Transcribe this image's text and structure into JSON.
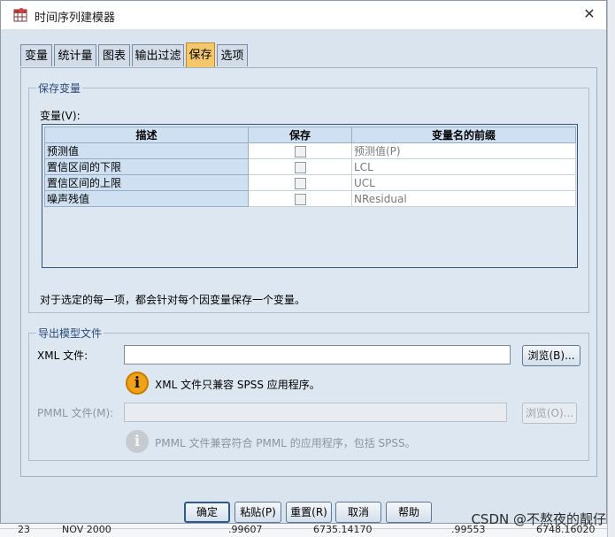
{
  "window": {
    "title": "时间序列建模器",
    "close_label": "✕"
  },
  "tabs": [
    {
      "label": "变量"
    },
    {
      "label": "统计量"
    },
    {
      "label": "图表"
    },
    {
      "label": "输出过滤"
    },
    {
      "label": "保存"
    },
    {
      "label": "选项"
    }
  ],
  "active_tab": "保存",
  "save_group": {
    "legend": "保存变量",
    "var_label": "变量(V):",
    "columns": [
      "描述",
      "保存",
      "变量名的前缀"
    ],
    "rows": [
      {
        "desc": "预测值",
        "save": false,
        "prefix": "预测值(P)"
      },
      {
        "desc": "置信区间的下限",
        "save": false,
        "prefix": "LCL"
      },
      {
        "desc": "置信区间的上限",
        "save": false,
        "prefix": "UCL"
      },
      {
        "desc": "噪声残值",
        "save": false,
        "prefix": "NResidual"
      }
    ],
    "note": "对于选定的每一项，都会针对每个因变量保存一个变量。"
  },
  "export_group": {
    "legend": "导出模型文件",
    "xml_label": "XML 文件:",
    "xml_value": "",
    "browse1_label": "浏览(B)...",
    "xml_info": "XML 文件只兼容 SPSS 应用程序。",
    "pmml_label": "PMML 文件(M):",
    "pmml_value": "",
    "browse2_label": "浏览(O)...",
    "pmml_info": "PMML 文件兼容符合 PMML 的应用程序，包括 SPSS。"
  },
  "buttons": {
    "ok": "确定",
    "paste": "粘贴(P)",
    "reset": "重置(R)",
    "cancel": "取消",
    "help": "帮助"
  },
  "background_row": {
    "index": "23",
    "date": "NOV 2000",
    "v1": ".99607",
    "v2": "6735.14170",
    "v3": ".99553",
    "v4": "6748.16020"
  },
  "watermark": "CSDN @不熬夜的靓仔",
  "colors": {
    "active_tab": "#f6c76a",
    "info_icon": "#f0a21b",
    "dialog_bg": "#d9e4ef"
  }
}
